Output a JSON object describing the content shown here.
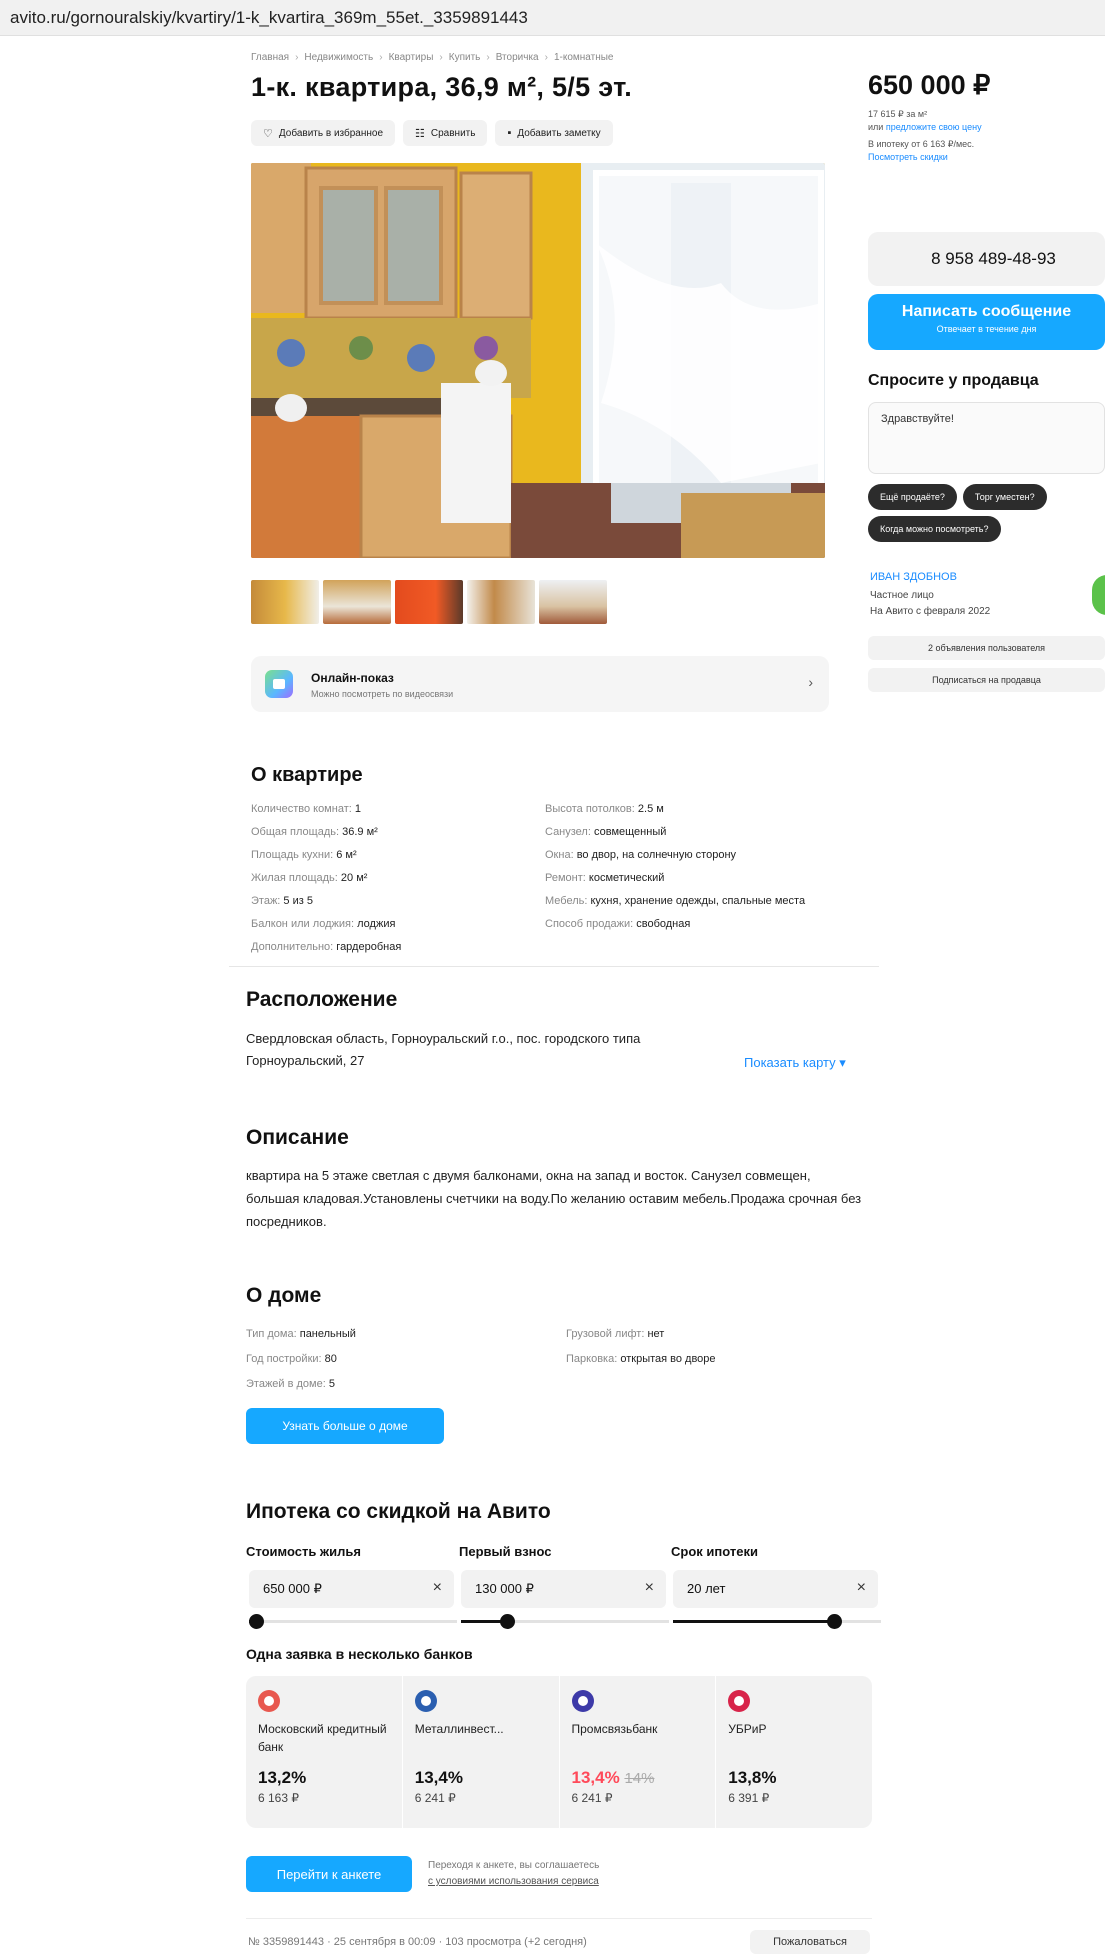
{
  "url": "avito.ru/gornouralskiy/kvartiry/1-k_kvartira_369m_55et._3359891443",
  "breadcrumb": [
    "Главная",
    "Недвижимость",
    "Квартиры",
    "Купить",
    "Вторичка",
    "1-комнатные"
  ],
  "breadcrumb_sep": "›",
  "title": "1-к. квартира, 36,9 м², 5/5 эт.",
  "actions": {
    "favorite": "Добавить в избранное",
    "compare": "Сравнить",
    "note": "Добавить заметку"
  },
  "icons": {
    "favorite": "heart-icon",
    "compare": "compare-icon",
    "note": "note-icon",
    "online": "video-call-icon",
    "chevron": "chevron-right-icon",
    "clear": "close-icon"
  },
  "online": {
    "title": "Онлайн-показ",
    "subtitle": "Можно посмотреть по видеосвязи",
    "chevron": "›"
  },
  "price": {
    "value": "650 000 ₽",
    "per_m2": "17 615 ₽ за м²",
    "or": "или",
    "offer": "предложите свою цену",
    "mortgage": "В ипотеку от 6 163 ₽/мес.",
    "discounts": "Посмотреть скидки"
  },
  "contact": {
    "phone": "8 958 489-48-93",
    "message": "Написать сообщение",
    "message_sub": "Отвечает в течение дня",
    "ask_title": "Спросите у продавца",
    "ask_text": "Здравствуйте!",
    "chips": [
      "Ещё продаёте?",
      "Торг уместен?",
      "Когда можно посмотреть?"
    ]
  },
  "seller": {
    "name": "ИВАН ЗДОБНОВ",
    "type": "Частное лицо",
    "since": "На Авито с февраля 2022",
    "ads": "2 объявления пользователя",
    "subscribe": "Подписаться на продавца"
  },
  "apartment": {
    "title": "О квартире",
    "left": [
      {
        "k": "Количество комнат",
        "v": "1"
      },
      {
        "k": "Общая площадь",
        "v": "36.9 м²"
      },
      {
        "k": "Площадь кухни",
        "v": "6 м²"
      },
      {
        "k": "Жилая площадь",
        "v": "20 м²"
      },
      {
        "k": "Этаж",
        "v": "5 из 5"
      },
      {
        "k": "Балкон или лоджия",
        "v": "лоджия"
      },
      {
        "k": "Дополнительно",
        "v": "гардеробная"
      }
    ],
    "right": [
      {
        "k": "Высота потолков",
        "v": "2.5 м"
      },
      {
        "k": "Санузел",
        "v": "совмещенный"
      },
      {
        "k": "Окна",
        "v": "во двор, на солнечную сторону"
      },
      {
        "k": "Ремонт",
        "v": "косметический"
      },
      {
        "k": "Мебель",
        "v": "кухня, хранение одежды, спальные места"
      },
      {
        "k": "Способ продажи",
        "v": "свободная"
      }
    ]
  },
  "location": {
    "title": "Расположение",
    "address": "Свердловская область, Горноуральский г.о., пос. городского типа Горноуральский, 27",
    "map_link": "Показать карту ▾"
  },
  "description": {
    "title": "Описание",
    "text": "квартира на 5 этаже светлая с двумя балконами, окна на запад и восток. Санузел совмещен, большая кладовая.Установлены счетчики на воду.По желанию оставим мебель.Продажа срочная без посредников."
  },
  "house": {
    "title": "О доме",
    "left": [
      {
        "k": "Тип дома",
        "v": "панельный"
      },
      {
        "k": "Год постройки",
        "v": "80"
      },
      {
        "k": "Этажей в доме",
        "v": "5"
      }
    ],
    "right": [
      {
        "k": "Грузовой лифт",
        "v": "нет"
      },
      {
        "k": "Парковка",
        "v": "открытая во дворе"
      }
    ],
    "button": "Узнать больше о доме"
  },
  "mortgage": {
    "title": "Ипотека со скидкой на Авито",
    "fields": [
      {
        "label": "Стоимость жилья",
        "value": "650 000 ₽",
        "level": 0.0
      },
      {
        "label": "Первый взнос",
        "value": "130 000 ₽",
        "level": 0.2
      },
      {
        "label": "Срок ипотеки",
        "value": "20 лет",
        "level": 0.8
      }
    ],
    "clear": "×",
    "banks_title": "Одна заявка в несколько банков",
    "banks": [
      {
        "name": "Московский кредитный банк",
        "rate": "13,2%",
        "old": "",
        "pay": "6 163 ₽",
        "color": "#e8584f"
      },
      {
        "name": "Металлинвест...",
        "rate": "13,4%",
        "old": "",
        "pay": "6 241 ₽",
        "color": "#2b5fb0"
      },
      {
        "name": "Промсвязьбанк",
        "rate": "13,4%",
        "old": "14%",
        "pay": "6 241 ₽",
        "color": "#3d3aa8"
      },
      {
        "name": "УБРиР",
        "rate": "13,8%",
        "old": "",
        "pay": "6 391 ₽",
        "color": "#d8244a"
      }
    ],
    "form_button": "Перейти к анкете",
    "terms_1": "Переходя к анкете, вы соглашаетесь",
    "terms_2": "с условиями использования сервиса"
  },
  "footer": {
    "meta": "№ 3359891443 · 25 сентября в 00:09 · 103 просмотра (+2 сегодня)",
    "complain": "Пожаловаться"
  },
  "colors": {
    "accent": "#16a8ff",
    "link": "#1a8cff",
    "discount": "#ff4a5a"
  }
}
